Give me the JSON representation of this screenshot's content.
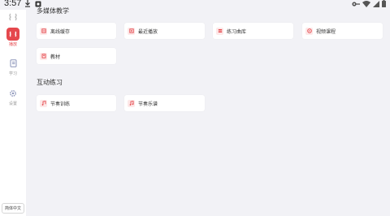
{
  "status_bar": {
    "time": "3:57",
    "icons": [
      "download-icon",
      "notification-square-icon",
      "vpn-key-icon",
      "wifi-icon",
      "signal-icon",
      "battery-icon"
    ]
  },
  "colors": {
    "accent": "#e5484d",
    "accent_soft": "#fde8e8",
    "background": "#f2f2f6",
    "card": "#ffffff"
  },
  "sidebar": {
    "items": [
      {
        "label": "播放",
        "icon": "play-icon",
        "active": true
      },
      {
        "label": "学习",
        "icon": "notebook-icon",
        "active": false
      },
      {
        "label": "设置",
        "icon": "gear-icon",
        "active": false
      }
    ],
    "language_button": "简体中文"
  },
  "sections": [
    {
      "title": "多媒体教学",
      "cards": [
        {
          "label": "离线缓存",
          "icon": "offline-cache-icon"
        },
        {
          "label": "最近播放",
          "icon": "recent-play-icon"
        },
        {
          "label": "练习曲库",
          "icon": "practice-library-icon"
        },
        {
          "label": "视频课程",
          "icon": "video-course-icon"
        },
        {
          "label": "教材",
          "icon": "textbook-icon"
        }
      ]
    },
    {
      "title": "互动练习",
      "cards": [
        {
          "label": "节奏训练",
          "icon": "rhythm-training-icon"
        },
        {
          "label": "节奏乐谱",
          "icon": "rhythm-score-icon"
        }
      ]
    }
  ]
}
